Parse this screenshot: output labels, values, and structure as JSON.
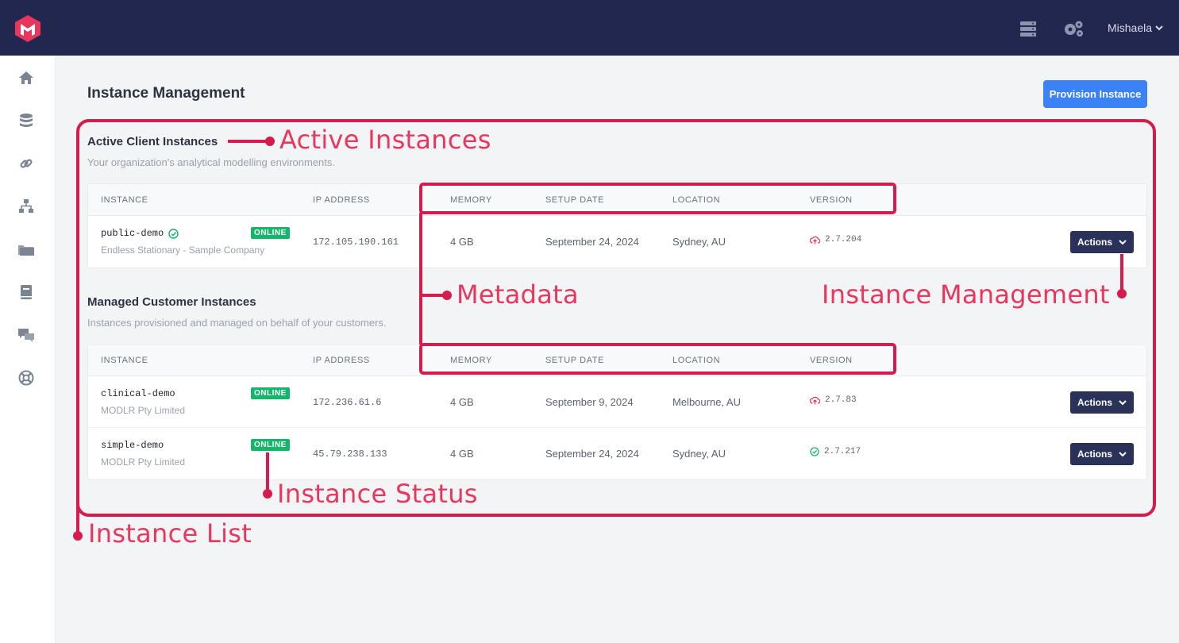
{
  "header": {
    "user_name": "Mishaela",
    "logo_icon": "modlr-logo-icon",
    "server_icon": "server-icon",
    "settings_icon": "gears-icon"
  },
  "sidebar": {
    "items": [
      {
        "icon": "home-icon"
      },
      {
        "icon": "database-icon"
      },
      {
        "icon": "link-icon"
      },
      {
        "icon": "network-icon"
      },
      {
        "icon": "folder-icon"
      },
      {
        "icon": "book-icon"
      },
      {
        "icon": "chat-icon"
      },
      {
        "icon": "support-icon"
      }
    ]
  },
  "page": {
    "title": "Instance Management",
    "provision_label": "Provision Instance"
  },
  "columns": [
    "INSTANCE",
    "IP ADDRESS",
    "MEMORY",
    "SETUP DATE",
    "LOCATION",
    "VERSION"
  ],
  "active_section": {
    "title": "Active Client Instances",
    "subtitle": "Your organization's analytical modelling environments.",
    "rows": [
      {
        "name": "public-demo",
        "verified": true,
        "company": "Endless Stationary - Sample Company",
        "status": "ONLINE",
        "ip": "172.105.190.161",
        "memory": "4 GB",
        "setup_date": "September 24, 2024",
        "location": "Sydney, AU",
        "version": "2.7.204",
        "version_state": "update",
        "actions": "Actions"
      }
    ]
  },
  "managed_section": {
    "title": "Managed Customer Instances",
    "subtitle": "Instances provisioned and managed on behalf of your customers.",
    "rows": [
      {
        "name": "clinical-demo",
        "verified": false,
        "company": "MODLR Pty Limited",
        "status": "ONLINE",
        "ip": "172.236.61.6",
        "memory": "4 GB",
        "setup_date": "September 9, 2024",
        "location": "Melbourne, AU",
        "version": "2.7.83",
        "version_state": "update",
        "actions": "Actions"
      },
      {
        "name": "simple-demo",
        "verified": false,
        "company": "MODLR Pty Limited",
        "status": "ONLINE",
        "ip": "45.79.238.133",
        "memory": "4 GB",
        "setup_date": "September 24, 2024",
        "location": "Sydney, AU",
        "version": "2.7.217",
        "version_state": "current",
        "actions": "Actions"
      }
    ]
  },
  "annotations": {
    "active_instances": "Active Instances",
    "metadata": "Metadata",
    "instance_management": "Instance Management",
    "instance_status": "Instance Status",
    "instance_list": "Instance List"
  },
  "colors": {
    "topbar": "#222750",
    "accent": "#3b82f6",
    "online": "#12b76a",
    "annotation": "#d81b4f",
    "annotation_text": "#e8365d"
  }
}
